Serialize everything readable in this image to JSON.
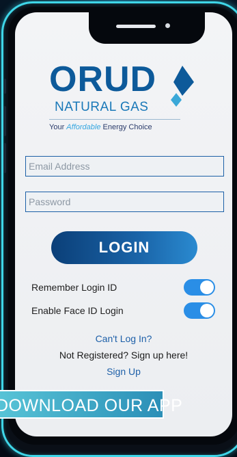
{
  "logo": {
    "brand": "ORUD",
    "subtitle": "NATURAL GAS",
    "tagline_prefix": "Your ",
    "tagline_emphasis": "Affordable",
    "tagline_suffix": " Energy Choice"
  },
  "form": {
    "email_placeholder": "Email Address",
    "password_placeholder": "Password",
    "login_label": "LOGIN"
  },
  "options": [
    {
      "label": "Remember Login ID",
      "enabled": true
    },
    {
      "label": "Enable Face ID Login",
      "enabled": true
    }
  ],
  "links": {
    "cant_login": "Can't Log In?",
    "not_registered": "Not Registered? Sign up here!",
    "sign_up": "Sign Up"
  },
  "banner": {
    "text": "DOWNLOAD OUR APP"
  },
  "colors": {
    "brand_blue": "#0d5a9a",
    "accent_cyan": "#3fd6e8",
    "toggle_on": "#2a8ee6"
  }
}
